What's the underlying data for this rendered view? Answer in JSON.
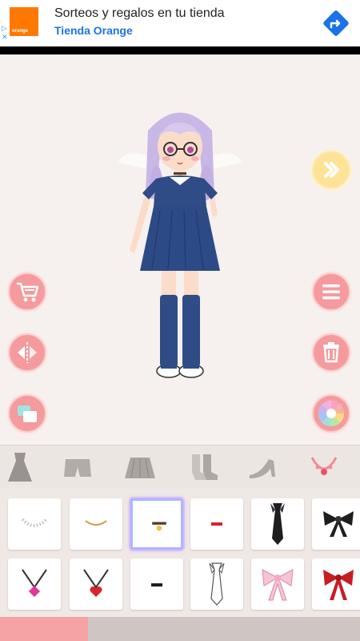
{
  "ad": {
    "logo_text": "orange",
    "title": "Sorteos y regalos en tu tienda",
    "subtitle": "Tienda Orange"
  },
  "colors": {
    "button_pink": "#f59a9d",
    "button_yellow": "#fde396",
    "background": "#f6f1ee",
    "tab_active": "#f5a3a3"
  },
  "stage": {
    "right_buttons": [
      "next-icon",
      "menu-icon",
      "trash-icon",
      "color-palette-icon"
    ],
    "left_buttons": [
      "shopping-cart-icon",
      "mirror-flip-icon",
      "layers-icon"
    ]
  },
  "categories": [
    "dress-icon",
    "shorts-icon",
    "skirt-icon",
    "socks-icon",
    "heels-icon",
    "necklace-icon"
  ],
  "items": {
    "row1": [
      "pearl-necklace",
      "gold-chain-necklace",
      "star-choker",
      "red-collar-bar",
      "black-tie",
      "black-bow"
    ],
    "row2": [
      "pink-gem-pendant",
      "red-heart-pendant",
      "black-collar-bar",
      "white-tie",
      "pink-ribbon-bow",
      "red-ribbon-bow"
    ],
    "selected": "star-choker"
  }
}
